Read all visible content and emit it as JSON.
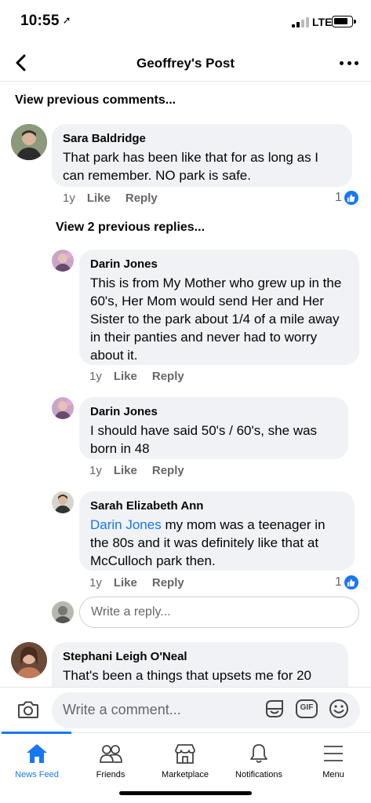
{
  "status_bar": {
    "time": "10:55",
    "network": "LTE"
  },
  "header": {
    "title": "Geoffrey's Post"
  },
  "view_previous_comments": "View previous comments...",
  "view_previous_replies": "View 2 previous replies...",
  "comments": [
    {
      "author": "Sara Baldridge",
      "text": "That park has been like that for as long as I can remember. NO park is safe.",
      "time": "1y",
      "like": "Like",
      "reply": "Reply",
      "reaction_count": "1"
    },
    {
      "author": "Darin Jones",
      "text": "This is from My Mother who grew up in the 60's, Her Mom would send Her and Her Sister to the park about 1/4 of a mile away in their panties and never had to worry about it.",
      "time": "1y",
      "like": "Like",
      "reply": "Reply"
    },
    {
      "author": "Darin Jones",
      "text": "I should have said 50's / 60's, she was born in 48",
      "time": "1y",
      "like": "Like",
      "reply": "Reply"
    },
    {
      "author": "Sarah Elizabeth Ann",
      "mention": "Darin Jones",
      "text": " my mom was a teenager in the 80s and it was definitely like that at McCulloch park then.",
      "time": "1y",
      "like": "Like",
      "reply": "Reply",
      "reaction_count": "1"
    },
    {
      "author": "Stephani Leigh O'Neal",
      "text": "That's been a things that upsets me for 20"
    }
  ],
  "reply_input": {
    "placeholder": "Write a reply..."
  },
  "composer": {
    "placeholder": "Write a comment...",
    "gif_label": "GIF"
  },
  "tabs": [
    {
      "label": "News Feed",
      "icon": "home-icon",
      "active": true
    },
    {
      "label": "Friends",
      "icon": "friends-icon"
    },
    {
      "label": "Marketplace",
      "icon": "marketplace-icon"
    },
    {
      "label": "Notifications",
      "icon": "bell-icon"
    },
    {
      "label": "Menu",
      "icon": "hamburger-icon"
    }
  ],
  "colors": {
    "accent": "#1877f2",
    "bubble": "#f0f2f5",
    "secondary_text": "#65676b"
  }
}
